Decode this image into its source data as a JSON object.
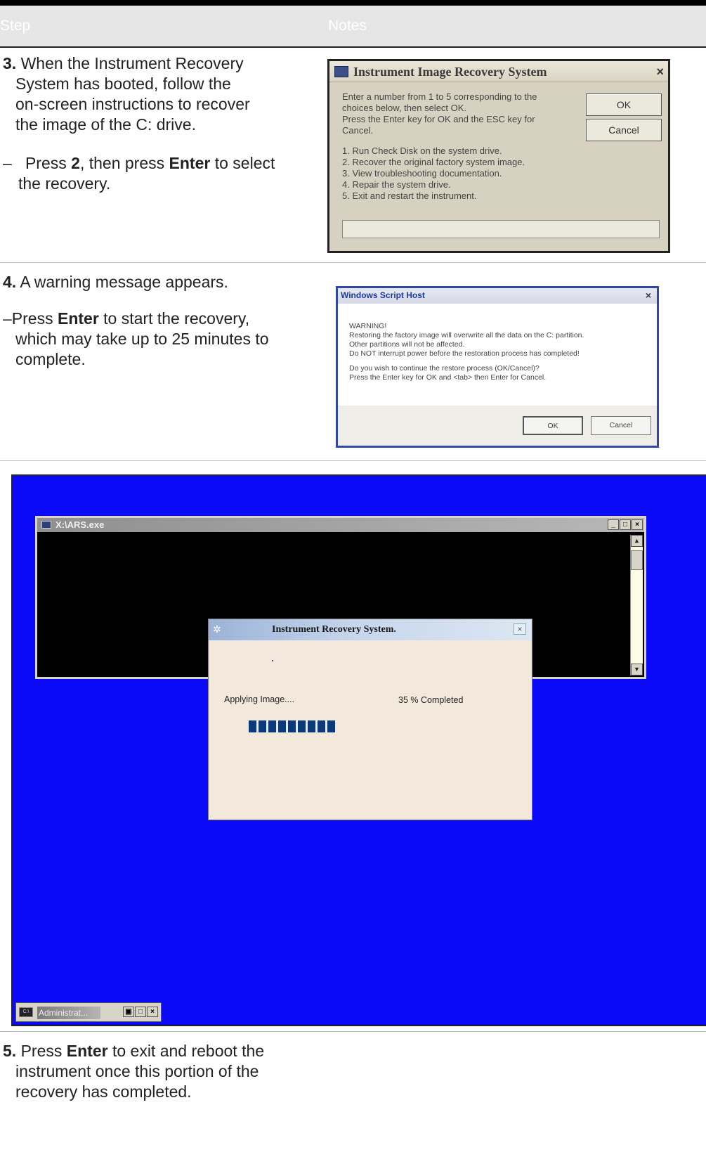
{
  "table": {
    "header_step": "Step",
    "header_notes": "Notes"
  },
  "step3": {
    "number": "3.",
    "text_line1": "When the Instrument Recovery",
    "text_line2": "System has booted, follow the",
    "text_line3": "on-screen instructions to recover",
    "text_line4": "the image of the C: drive.",
    "bullet_dash": "–",
    "bullet_pre": "Press ",
    "bullet_key1": "2",
    "bullet_mid": ", then press ",
    "bullet_key2": "Enter",
    "bullet_post": " to select",
    "bullet_line2": "the recovery."
  },
  "recovery_dialog": {
    "title": "Instrument Image Recovery System",
    "close": "×",
    "lines": [
      "Enter a number from 1 to 5 corresponding to the",
      "choices below, then select OK.",
      "Press the Enter key for OK and the ESC key for",
      "Cancel.",
      "1. Run Check Disk on the system drive.",
      "2. Recover the original factory system image.",
      "3. View troubleshooting documentation.",
      "4. Repair the system drive.",
      "5. Exit and restart the instrument."
    ],
    "ok": "OK",
    "cancel": "Cancel",
    "input_value": ""
  },
  "step4": {
    "number": "4.",
    "text": "A warning message appears.",
    "bullet_pre": "–Press ",
    "bullet_key": "Enter",
    "bullet_post": " to start the recovery,",
    "bullet_line2": "which may take up to 25 minutes to",
    "bullet_line3": "complete."
  },
  "script_dialog": {
    "title": "Windows Script Host",
    "close": "×",
    "lines": [
      "WARNING!",
      "Restoring the factory image will overwrite all the data on the C: partition.",
      "Other partitions will not be affected.",
      "Do NOT interrupt power before the restoration process has completed!",
      "Do you wish to continue the restore process (OK/Cancel)?",
      "Press the Enter key for OK and <tab> then Enter for Cancel."
    ],
    "ok": "OK",
    "cancel": "Cancel"
  },
  "console": {
    "title": "X:\\ARS.exe",
    "min": "_",
    "max": "□",
    "close": "×",
    "scroll_up": "▲",
    "scroll_down": "▼"
  },
  "progress_dialog": {
    "title": "Instrument Recovery System.",
    "close": "×",
    "status": "Applying Image....",
    "percent_text": "35 % Completed",
    "progress_fraction": 0.35
  },
  "taskbar": {
    "icon_text": "C:\\",
    "label": "Administrat...",
    "restore": "▣",
    "max": "□",
    "close": "×"
  },
  "step5": {
    "number": "5.",
    "pre": "Press ",
    "key": "Enter",
    "post": " to exit and reboot the",
    "line2": "instrument once this portion of the",
    "line3": "recovery has completed."
  },
  "colors": {
    "desktop_blue": "#0a0af8",
    "progress_blue": "#0b3a7a",
    "dialog_beige": "#d6d1c0"
  }
}
